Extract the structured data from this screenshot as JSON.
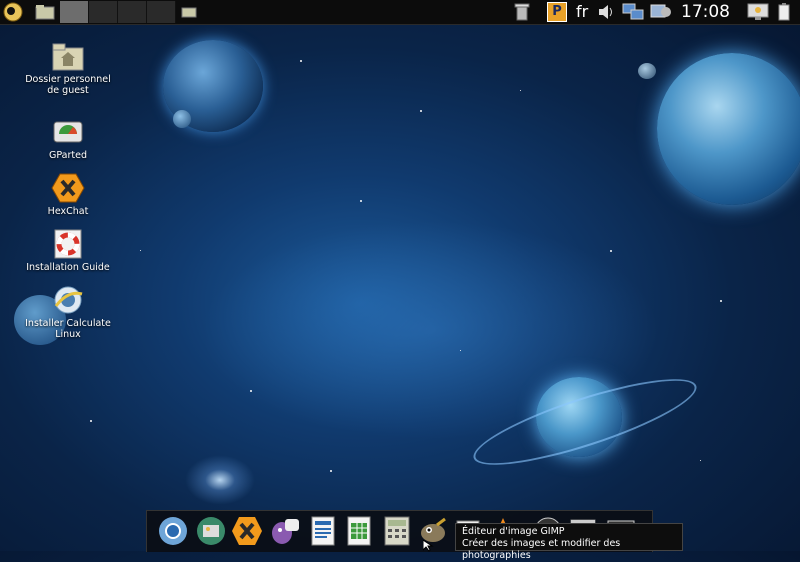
{
  "top_panel": {
    "menu_icon": "distro-logo-icon",
    "workspaces": [
      "",
      "",
      "",
      ""
    ],
    "tray": {
      "trash": "trash-icon",
      "parcellite": "P",
      "language": "fr",
      "volume": "volume-icon",
      "network": "network-icon",
      "users": "users-icon",
      "clock": "17:08",
      "screen": "monitor-icon",
      "power": "battery-icon"
    }
  },
  "desktop": {
    "icons": [
      {
        "label": "Dossier personnel de guest",
        "icon": "home-folder-icon"
      },
      {
        "label": "GParted",
        "icon": "gparted-icon"
      },
      {
        "label": "HexChat",
        "icon": "hexchat-icon"
      },
      {
        "label": "Installation Guide",
        "icon": "lifebuoy-icon"
      },
      {
        "label": "Installer Calculate Linux",
        "icon": "installer-icon"
      }
    ]
  },
  "dock": {
    "items": [
      "chromium-icon",
      "photos-icon",
      "hexchat-icon",
      "pidgin-icon",
      "writer-icon",
      "calc-icon",
      "calculator-icon",
      "gimp-icon",
      "files-icon",
      "vlc-icon",
      "media-icon",
      "calendar-icon",
      "screen-icon"
    ]
  },
  "tooltip": {
    "title": "Éditeur d'image GIMP",
    "subtitle": "Créer des images et modifier des photographies"
  }
}
